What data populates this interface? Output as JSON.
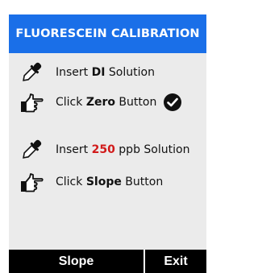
{
  "header": {
    "title": "FLUORESCEIN CALIBRATION",
    "color": "#1a6fe8"
  },
  "steps": [
    {
      "icon": "dropper-icon",
      "prefix": "Insert ",
      "strong": "DI",
      "suffix": " Solution"
    },
    {
      "icon": "pointing-hand-icon",
      "prefix": "Click ",
      "strong": "Zero",
      "suffix": " Button",
      "status": "check-circle-icon"
    },
    {
      "icon": "dropper-icon",
      "prefix": "Insert ",
      "strong": "250",
      "suffix": " ppb Solution",
      "strong_color": "#d11a1a"
    },
    {
      "icon": "pointing-hand-icon",
      "prefix": "Click ",
      "strong": "Slope",
      "suffix": " Button"
    }
  ],
  "buttons": {
    "slope": "Slope",
    "exit": "Exit"
  }
}
